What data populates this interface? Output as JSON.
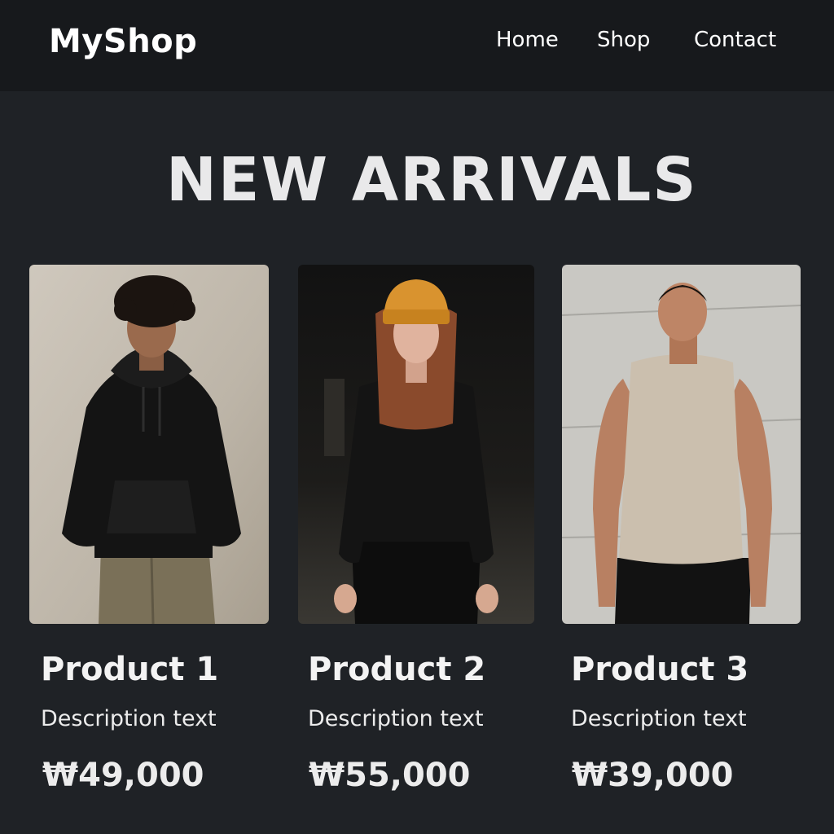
{
  "header": {
    "brand": "MyShop",
    "nav": [
      "Home",
      "Shop",
      "Contact"
    ]
  },
  "hero": {
    "title": "NEW ARRIVALS"
  },
  "products": [
    {
      "name": "Product 1",
      "description": "Description text",
      "price": "₩49,000"
    },
    {
      "name": "Product 2",
      "description": "Description text",
      "price": "₩55,000"
    },
    {
      "name": "Product 3",
      "description": "Description text",
      "price": "₩39,000"
    }
  ]
}
